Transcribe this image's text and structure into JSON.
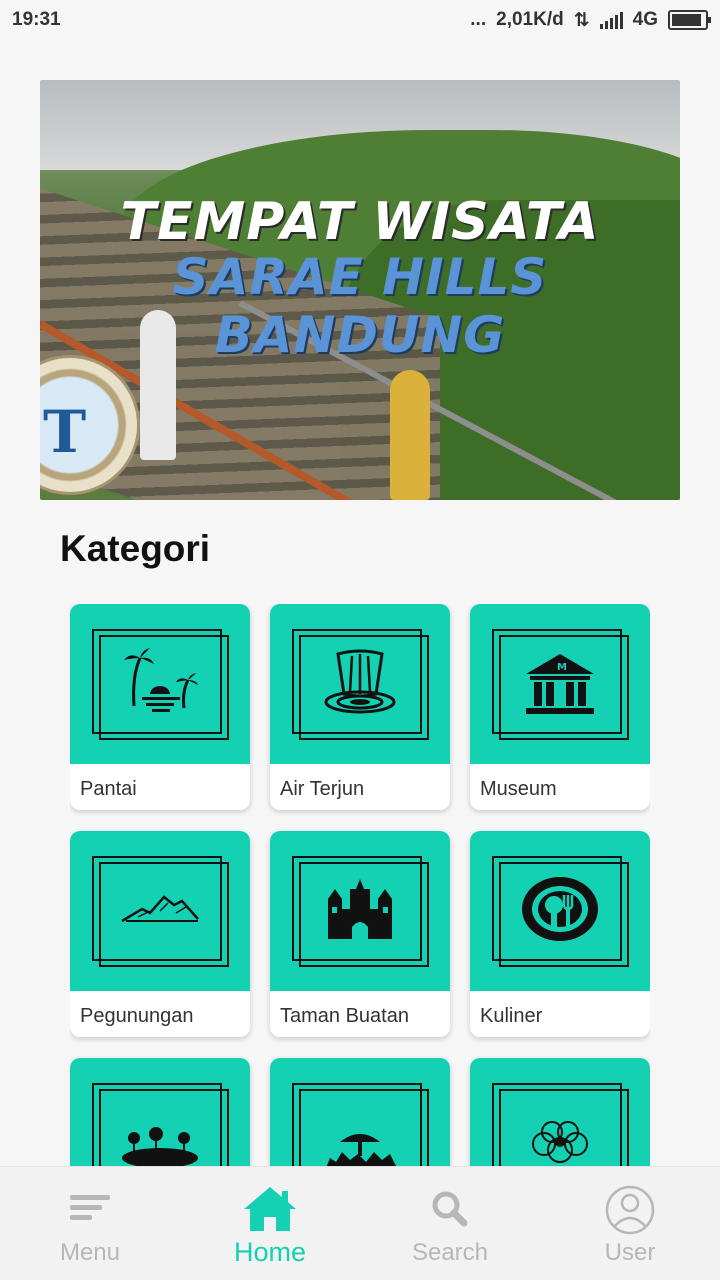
{
  "status_bar": {
    "time": "19:31",
    "dots": "...",
    "network_speed": "2,01K/d",
    "network_type": "4G"
  },
  "banner": {
    "title_line1": "TEMPAT WISATA",
    "title_line2": "SARAE HILLS BANDUNG",
    "badge_letter": "T",
    "carousel": {
      "count": 4,
      "active_index": 2
    }
  },
  "section": {
    "title": "Kategori"
  },
  "categories": [
    {
      "label": "Pantai",
      "icon": "palm-beach-icon"
    },
    {
      "label": "Air Terjun",
      "icon": "waterfall-icon"
    },
    {
      "label": "Museum",
      "icon": "museum-icon"
    },
    {
      "label": "Pegunungan",
      "icon": "mountain-icon"
    },
    {
      "label": "Taman Buatan",
      "icon": "castle-icon"
    },
    {
      "label": "Kuliner",
      "icon": "restaurant-icon"
    },
    {
      "label": "",
      "icon": "lake-trees-icon"
    },
    {
      "label": "",
      "icon": "wildlife-icon"
    },
    {
      "label": "",
      "icon": "flower-icon"
    }
  ],
  "bottom_nav": {
    "items": [
      {
        "label": "Menu",
        "icon": "menu-icon"
      },
      {
        "label": "Home",
        "icon": "home-icon",
        "active": true
      },
      {
        "label": "Search",
        "icon": "search-icon"
      },
      {
        "label": "User",
        "icon": "user-icon"
      }
    ],
    "active_color": "#14d1b4",
    "inactive_color": "#b7b7b7"
  },
  "colors": {
    "accent": "#14d1b4"
  }
}
